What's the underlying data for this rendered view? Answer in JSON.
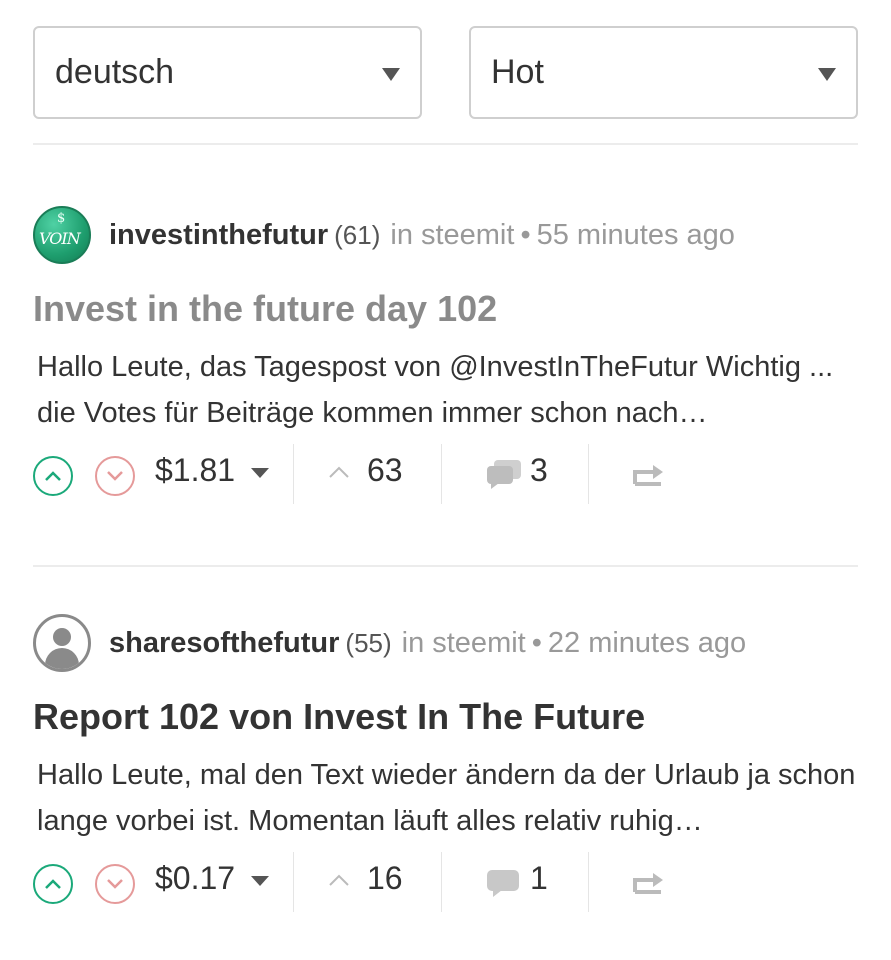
{
  "filters": {
    "language": "deutsch",
    "sort": "Hot"
  },
  "posts": [
    {
      "author": "investinthefutur",
      "reputation": "(61)",
      "in_label": "in",
      "community": "steemit",
      "dot": "•",
      "time": "55 minutes ago",
      "avatar": "voin-logo",
      "avatar_text": "VOIN",
      "title": "Invest in the future day 102",
      "body": "Hallo Leute, das Tagespost von @InvestInTheFutur Wichtig ... die Votes für Beiträge kommen immer schon nach…",
      "payout": "$1.81",
      "votes": "63",
      "comments": "3"
    },
    {
      "author": "sharesofthefutur",
      "reputation": "(55)",
      "in_label": "in",
      "community": "steemit",
      "dot": "•",
      "time": "22 minutes ago",
      "avatar": "default-user-icon",
      "title": "Report 102 von Invest In The Future",
      "body": "Hallo Leute, mal den Text wieder ändern da der Urlaub ja schon lange vorbei ist. Momentan läuft alles relativ ruhig…",
      "payout": "$0.17",
      "votes": "16",
      "comments": "1"
    }
  ],
  "colors": {
    "upvote": "#1ba97a",
    "downvote": "#e59a9a",
    "muted": "#999999",
    "text": "#333333"
  }
}
